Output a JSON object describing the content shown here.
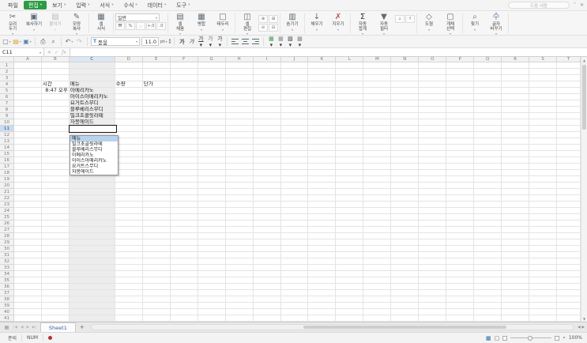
{
  "window": {
    "help_search_placeholder": "도움 내용",
    "collapse_icon": "˄",
    "close_icon": "✕"
  },
  "menu_bar": {
    "items": [
      {
        "label": "파일",
        "caret": false,
        "active": false
      },
      {
        "label": "편집",
        "caret": true,
        "active": true
      },
      {
        "label": "보기",
        "caret": true,
        "active": false
      },
      {
        "label": "입력",
        "caret": true,
        "active": false
      },
      {
        "label": "서식",
        "caret": true,
        "active": false
      },
      {
        "label": "수식",
        "caret": true,
        "active": false
      },
      {
        "label": "데이터",
        "caret": true,
        "active": false
      },
      {
        "label": "도구",
        "caret": true,
        "active": false
      }
    ],
    "accent_color": "#2d9b44"
  },
  "ribbon": {
    "groups": [
      {
        "buttons": [
          {
            "name": "cut-button",
            "icon_name": "scissors-icon",
            "glyph": "✂",
            "label": "오려\n두기",
            "caret": true
          },
          {
            "name": "copy-button",
            "icon_name": "copy-icon",
            "glyph": "▣",
            "label": "복사하기",
            "caret": true
          },
          {
            "name": "paste-button",
            "icon_name": "paste-icon",
            "glyph": "▤",
            "label": "붙이기",
            "caret": true,
            "disabled": true
          },
          {
            "name": "format-copy-button",
            "icon_name": "format-painter-icon",
            "glyph": "✎",
            "label": "모양\n복사",
            "caret": true
          }
        ]
      },
      {
        "buttons": [
          {
            "name": "cell-format-button",
            "icon_name": "cell-format-icon",
            "glyph": "▦",
            "label": "셀\n서식",
            "caret": false
          }
        ]
      },
      {
        "type": "number-format",
        "select": {
          "name": "number-format-select",
          "value": "일반"
        },
        "minis": [
          {
            "name": "currency-style-button",
            "icon_name": "currency-icon",
            "glyph": "₩"
          },
          {
            "name": "percent-style-button",
            "icon_name": "percent-icon",
            "glyph": "%"
          },
          {
            "name": "comma-style-button",
            "icon_name": "comma-icon",
            "glyph": ","
          },
          {
            "name": "increase-decimal-button",
            "icon_name": "increase-decimal-icon",
            "glyph": "+.0"
          },
          {
            "name": "decrease-decimal-button",
            "icon_name": "decrease-decimal-icon",
            "glyph": ".0"
          }
        ]
      },
      {
        "buttons": [
          {
            "name": "cell-fill-button",
            "icon_name": "cell-fill-icon",
            "glyph": "▤",
            "label": "셀\n채움",
            "caret": true
          },
          {
            "name": "merge-button",
            "icon_name": "merge-cells-icon",
            "glyph": "▦",
            "label": "병합",
            "caret": true
          },
          {
            "name": "border-button",
            "icon_name": "borders-icon",
            "glyph": "□",
            "label": "테두리",
            "caret": true
          }
        ]
      },
      {
        "buttons": [
          {
            "name": "cell-edit-button",
            "icon_name": "cell-edit-icon",
            "glyph": "◫",
            "label": "셀\n편집",
            "caret": true
          }
        ],
        "cluster": [
          {
            "name": "insert-row-button",
            "icon_name": "insert-row-icon",
            "glyph": "⊕"
          },
          {
            "name": "insert-column-button",
            "icon_name": "insert-column-icon",
            "glyph": "⊞"
          },
          {
            "name": "delete-row-button",
            "icon_name": "delete-row-icon",
            "glyph": "⊖"
          },
          {
            "name": "delete-column-button",
            "icon_name": "delete-column-icon",
            "glyph": "⊟"
          }
        ]
      },
      {
        "buttons": [
          {
            "name": "hide-button",
            "icon_name": "hide-icon",
            "glyph": "▥",
            "label": "숨기기",
            "caret": true
          }
        ]
      },
      {
        "buttons": [
          {
            "name": "fill-button",
            "icon_name": "fill-down-icon",
            "glyph": "↓",
            "label": "채우기",
            "caret": true
          },
          {
            "name": "clear-button",
            "icon_name": "clear-icon",
            "glyph": "✗",
            "label": "지우기",
            "caret": true,
            "color": "#c0504d"
          }
        ]
      },
      {
        "buttons": [
          {
            "name": "autosum-button",
            "icon_name": "sigma-icon",
            "glyph": "Σ",
            "label": "자동\n합계",
            "caret": true,
            "color": "#333333"
          },
          {
            "name": "autofilter-button",
            "icon_name": "filter-icon",
            "glyph": "▼",
            "label": "자동\n필터",
            "caret": true
          }
        ],
        "cluster": [
          {
            "name": "sort-ascending-button",
            "icon_name": "sort-ascending-icon",
            "glyph": "↓"
          },
          {
            "name": "sort-descending-button",
            "icon_name": "sort-descending-icon",
            "glyph": "↑"
          }
        ]
      },
      {
        "buttons": [
          {
            "name": "shape-button",
            "icon_name": "shapes-icon",
            "glyph": "◇",
            "label": "도형",
            "caret": true
          },
          {
            "name": "object-select-button",
            "icon_name": "object-select-icon",
            "glyph": "▢",
            "label": "개체\n선택",
            "caret": true
          }
        ]
      },
      {
        "buttons": [
          {
            "name": "find-button",
            "icon_name": "binoculars-icon",
            "glyph": "⌕",
            "label": "찾기",
            "caret": true
          },
          {
            "name": "replace-button",
            "icon_name": "replace-text-icon",
            "glyph": "수",
            "label": "글자\n바꾸기",
            "caret": true,
            "color": "#4f81bd"
          }
        ]
      }
    ]
  },
  "toolbar2": {
    "font_name": "돋움",
    "font_size": "11.0",
    "font_unit": "pt",
    "items": [
      {
        "kind": "btn",
        "name": "new-document-button",
        "icon_name": "new-document-icon",
        "glyph": "▢",
        "caret": true
      },
      {
        "kind": "btn",
        "name": "open-file-button",
        "icon_name": "open-folder-icon",
        "glyph": "▤",
        "caret": true,
        "color": "#d9a43b"
      },
      {
        "kind": "btn",
        "name": "save-button",
        "icon_name": "save-icon",
        "glyph": "▣",
        "caret": true,
        "color": "#5b83b5"
      },
      {
        "kind": "sep"
      },
      {
        "kind": "btn",
        "name": "print-button",
        "icon_name": "printer-icon",
        "glyph": "⎙"
      },
      {
        "kind": "btn",
        "name": "print-preview-button",
        "icon_name": "preview-icon",
        "glyph": "⌕"
      },
      {
        "kind": "sep"
      },
      {
        "kind": "btn",
        "name": "undo-button",
        "icon_name": "undo-icon",
        "glyph": "↶",
        "caret": true
      },
      {
        "kind": "btn",
        "name": "redo-button",
        "icon_name": "redo-icon",
        "glyph": "↷",
        "disabled": true
      },
      {
        "kind": "sep"
      },
      {
        "kind": "font",
        "name": "font-name-select"
      },
      {
        "kind": "size",
        "name": "font-size-input"
      },
      {
        "kind": "sep"
      },
      {
        "kind": "style",
        "name": "bold-button",
        "icon_name": "bold-icon",
        "glyph": "가",
        "cls": "sb"
      },
      {
        "kind": "style",
        "name": "italic-button",
        "icon_name": "italic-icon",
        "glyph": "가",
        "cls": "si"
      },
      {
        "kind": "style",
        "name": "underline-button",
        "icon_name": "underline-icon",
        "glyph": "가",
        "cls": "su",
        "caret": true
      },
      {
        "kind": "style",
        "name": "outline-button",
        "icon_name": "font-effect-icon",
        "glyph": "가",
        "cls": "so",
        "caret": true
      },
      {
        "kind": "style",
        "name": "font-color-button",
        "icon_name": "font-color-icon",
        "glyph": "가",
        "bar": "#d03a3a",
        "caret": true
      },
      {
        "kind": "sep"
      },
      {
        "kind": "align",
        "name": "align-left-button",
        "icon_name": "align-left-icon",
        "dir": "l"
      },
      {
        "kind": "align",
        "name": "align-center-button",
        "icon_name": "align-center-icon",
        "dir": "c"
      },
      {
        "kind": "align",
        "name": "align-right-button",
        "icon_name": "align-right-icon",
        "dir": "r"
      },
      {
        "kind": "sep"
      },
      {
        "kind": "style",
        "name": "merge-cells-button",
        "icon_name": "merge-cells-icon",
        "glyph": "▦",
        "color": "#3f9d4c",
        "caret": true
      },
      {
        "kind": "style",
        "name": "borders-button",
        "icon_name": "borders-icon",
        "glyph": "▦",
        "color": "#8a8a8a",
        "caret": true
      },
      {
        "kind": "style",
        "name": "fill-color-button",
        "icon_name": "fill-color-icon",
        "glyph": "▨",
        "bar": "#e8c93a",
        "caret": true
      },
      {
        "kind": "style",
        "name": "pattern-button",
        "icon_name": "pattern-icon",
        "glyph": "▩",
        "color": "#8a8a8a",
        "caret": true
      }
    ]
  },
  "formula_bar": {
    "name_box": "C11",
    "cancel_glyph": "✕",
    "accept_glyph": "✓",
    "fx_glyph": "ƒx",
    "value": ""
  },
  "grid": {
    "columns": [
      "A",
      "B",
      "C",
      "D",
      "E",
      "F",
      "G",
      "H",
      "I",
      "J",
      "K",
      "L",
      "M",
      "N",
      "O",
      "P",
      "Q",
      "R",
      "S",
      "T"
    ],
    "row_count": 41,
    "selected_column": "C",
    "selected_row": 11,
    "tinted_column": "C",
    "cells": {
      "B4": {
        "v": "시간"
      },
      "C4": {
        "v": "메뉴"
      },
      "D4": {
        "v": "수량"
      },
      "E4": {
        "v": "단가"
      },
      "B5": {
        "v": "8:47 오후",
        "align": "right"
      },
      "C5": {
        "v": "아메리카노"
      },
      "C6": {
        "v": "아이스아메리카노"
      },
      "C7": {
        "v": "요거트스무디"
      },
      "C8": {
        "v": "블루베리스무디"
      },
      "C9": {
        "v": "밀크초콜릿라떼"
      },
      "C10": {
        "v": "자몽에이드"
      }
    }
  },
  "dropdown": {
    "items": [
      "메뉴",
      "밀크초콜릿라떼",
      "블루베리스무디",
      "아메리카노",
      "아이스아메리카노",
      "요거트스무디",
      "자몽에이드"
    ],
    "selected_index": 0
  },
  "sheet_tabs": {
    "nav_arrows": [
      "|◀",
      "◀",
      "▶",
      "▶|"
    ],
    "tabs": [
      "Sheet1"
    ],
    "active_tab": "Sheet1",
    "add_label": "+"
  },
  "status_bar": {
    "ready_label": "준비",
    "num_label": "NUM",
    "zoom_label": "100%"
  }
}
